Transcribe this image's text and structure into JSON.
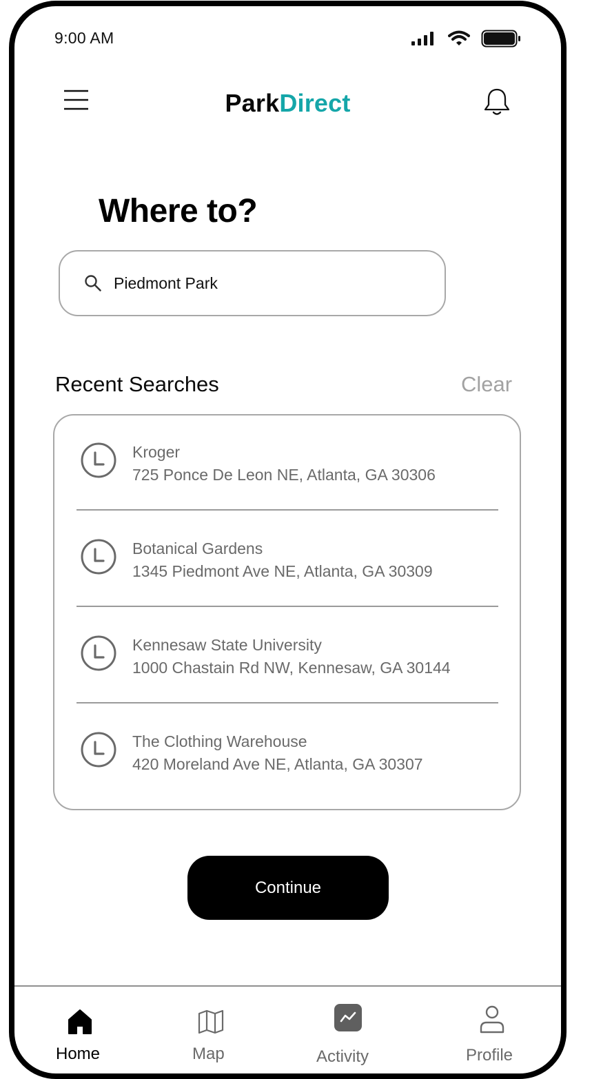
{
  "status_bar": {
    "time": "9:00 AM",
    "icons": [
      "signal-icon",
      "wifi-icon",
      "battery-icon"
    ]
  },
  "header": {
    "logo_part1": "Park",
    "logo_part2": "Direct",
    "icons": [
      "menu-icon",
      "bell-icon"
    ]
  },
  "main": {
    "title": "Where to?",
    "search": {
      "value": "Piedmont Park",
      "placeholder": "",
      "icon": "search-icon"
    },
    "recent_title": "Recent Searches",
    "clear_label": "Clear",
    "recent": [
      {
        "name": "Kroger",
        "address": "725 Ponce De Leon NE, Atlanta, GA 30306"
      },
      {
        "name": "Botanical Gardens",
        "address": "1345 Piedmont Ave NE, Atlanta, GA 30309"
      },
      {
        "name": "Kennesaw State University",
        "address": "1000 Chastain Rd NW, Kennesaw, GA 30144"
      },
      {
        "name": "The Clothing Warehouse",
        "address": "420 Moreland Ave NE, Atlanta, GA 30307"
      }
    ],
    "continue_label": "Continue"
  },
  "tabbar": {
    "items": [
      {
        "label": "Home",
        "icon": "home-icon",
        "active": true
      },
      {
        "label": "Map",
        "icon": "map-icon",
        "active": false
      },
      {
        "label": "Activity",
        "icon": "activity-icon",
        "active": false
      },
      {
        "label": "Profile",
        "icon": "profile-icon",
        "active": false
      }
    ]
  },
  "colors": {
    "brand_accent": "#15a6a9",
    "primary": "#000000",
    "muted_text": "#6a6a6a",
    "border": "#a8a8a8"
  }
}
